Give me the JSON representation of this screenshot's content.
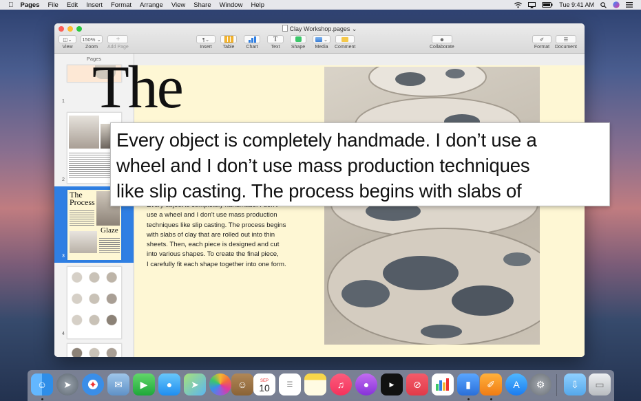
{
  "menubar": {
    "app": "Pages",
    "items": [
      "File",
      "Edit",
      "Insert",
      "Format",
      "Arrange",
      "View",
      "Share",
      "Window",
      "Help"
    ],
    "clock": "Tue 9:41 AM"
  },
  "window": {
    "title": "Clay Workshop.pages",
    "toolbar": {
      "view": "View",
      "zoom": "Zoom",
      "zoom_value": "150%",
      "add_page": "Add Page",
      "insert": "Insert",
      "table": "Table",
      "chart": "Chart",
      "text": "Text",
      "shape": "Shape",
      "media": "Media",
      "comment": "Comment",
      "collaborate": "Collaborate",
      "format": "Format",
      "document": "Document"
    }
  },
  "sidebar": {
    "header": "Pages",
    "pages": [
      {
        "num": "1"
      },
      {
        "num": "2"
      },
      {
        "num": "3",
        "t1": "The",
        "t2": "Process",
        "t3": "Glaze"
      },
      {
        "num": "4"
      }
    ]
  },
  "document": {
    "heading": "The",
    "body_lines": [
      "Every object is completely handmade. I don't",
      "use a wheel and I don't use mass production",
      "techniques like slip casting. The process begins",
      "with slabs of clay that are rolled out into thin",
      "sheets. Then, each piece is designed and cut",
      "into various shapes. To create the final piece,",
      "I carefully fit each shape together into one form."
    ]
  },
  "hover_text": {
    "lines": [
      "Every object is completely handmade. I don’t use a",
      "wheel and I don’t use mass production techniques",
      "like slip casting. The process begins with slabs of"
    ]
  },
  "colors": {
    "accent": "#2f7fe3",
    "page_bg": "#fef7d4",
    "close": "#fc5f57",
    "minimize": "#fdbc2e",
    "zoom": "#28c840"
  },
  "dock": {
    "calendar_month": "SEP",
    "calendar_day": "10",
    "icons": [
      "finder-icon",
      "launchpad-icon",
      "safari-icon",
      "mail-icon",
      "facetime-icon",
      "messages-icon",
      "maps-icon",
      "photos-icon",
      "contacts-icon",
      "calendar-icon",
      "reminders-icon",
      "notes-icon",
      "music-icon",
      "podcasts-icon",
      "tv-icon",
      "news-icon",
      "numbers-icon",
      "keynote-icon",
      "pages-icon",
      "app-store-icon",
      "system-preferences-icon",
      "downloads-icon",
      "trash-icon"
    ]
  }
}
